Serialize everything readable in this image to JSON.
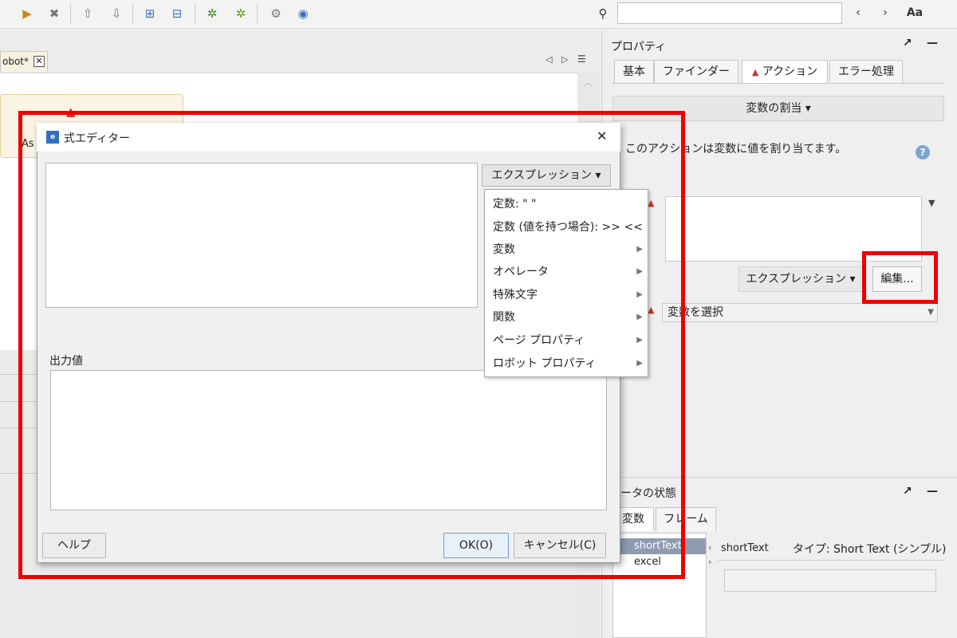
{
  "search": {
    "placeholder": ""
  },
  "toolbar": {
    "back": "‹",
    "forward": "›",
    "case": "Aa"
  },
  "editor_tab": {
    "label": "obot*",
    "close": "✕"
  },
  "node": {
    "label": "As"
  },
  "properties": {
    "title": "プロパティ",
    "tabs": [
      "基本",
      "ファインダー",
      "アクション",
      "エラー処理"
    ],
    "assign_button": "変数の割当 ▾",
    "description": "このアクションは変数に値を割り当てます。",
    "expression_button": "エクスプレッション ▾",
    "edit_button": "編集...",
    "variable_select": "変数を選択"
  },
  "data_state": {
    "title": "ータの状態",
    "tabs": [
      "変数",
      "フレーム"
    ],
    "variables": [
      "shortText",
      "excel"
    ],
    "selected_name": "shortText",
    "selected_type": "タイプ: Short Text (シンプル)"
  },
  "dialog": {
    "title": "式エディター",
    "close": "✕",
    "expression_button": "エクスプレッション ▾",
    "output_label": "出力値",
    "help_button": "ヘルプ",
    "ok_button": "OK(O)",
    "cancel_button": "キャンセル(C)"
  },
  "menu": {
    "items": [
      {
        "label": "定数: \" \""
      },
      {
        "label": "定数 (値を持つ場合): >> <<"
      },
      {
        "label": "変数"
      },
      {
        "label": "オペレータ"
      },
      {
        "label": "特殊文字"
      },
      {
        "label": "関数"
      },
      {
        "label": "ページ プロパティ"
      },
      {
        "label": "ロボット プロパティ"
      }
    ]
  },
  "colors": {
    "highlight": "#ee0000",
    "selection": "#8f9bb3",
    "warning": "#c0392b"
  }
}
